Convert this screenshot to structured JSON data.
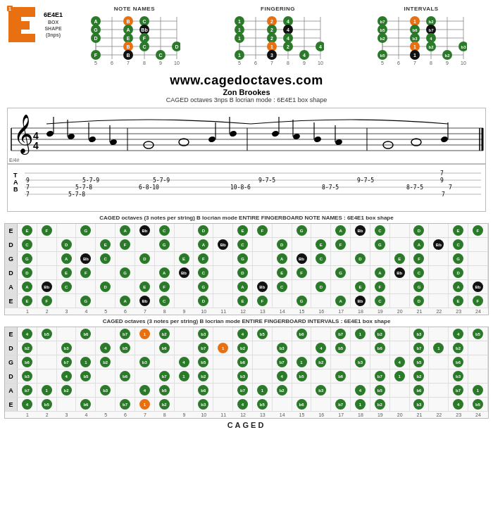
{
  "site": {
    "url": "www.cagedoctaves.com",
    "author": "Zon Brookes",
    "description": "CAGED octaves 3nps B locrian mode  : 6E4E1 box shape"
  },
  "shape": {
    "label": "6E4E1",
    "type": "BOX",
    "subtype": "SHAPE",
    "note": "(3nps)",
    "fret_number": "1"
  },
  "diagrams": {
    "note_names": {
      "title": "NOTE NAMES"
    },
    "fingering": {
      "title": "FINGERING"
    },
    "intervals": {
      "title": "INTERVALS"
    }
  },
  "tab": {
    "label_e": "E",
    "label_a": "A",
    "label_b": "B",
    "fret_markers": "5  6  7  8  9  10",
    "e_row": "e|-----------------------------------7-",
    "a_row": "A|9---------------------------------9--",
    "b_row": "B|7--5-7-8--5-7-9--6-8-10--10-8-6--8-7-5--9-7-5--8-7-5---7"
  },
  "fingerboard_notes": {
    "title1": "CAGED octaves (3 notes per string) B locrian mode ENTIRE FINGERBOARD  NOTE NAMES : 6E4E1 box  shape",
    "title2": "CAGED octaves (3 notes per string) B locrian mode ENTIRE FINGERBOARD INTERVALS : 6E4E1 box shape",
    "strings": [
      "E",
      "D",
      "G",
      "D",
      "A",
      "E"
    ],
    "fret_numbers": [
      "1",
      "2",
      "3",
      "4",
      "5",
      "6",
      "7",
      "8",
      "9",
      "10",
      "11",
      "12",
      "13",
      "14",
      "15",
      "16",
      "17",
      "18",
      "19",
      "20",
      "21",
      "22",
      "23",
      "24"
    ],
    "note_rows": [
      [
        "E",
        "F",
        "",
        "G",
        "",
        "A",
        "Bb",
        "C",
        "",
        "D",
        "",
        "E",
        "F",
        "",
        "G",
        "",
        "A",
        "Bb",
        "C",
        "",
        "D",
        "",
        "E",
        "F"
      ],
      [
        "C",
        "",
        "D",
        "",
        "E",
        "F",
        "",
        "G",
        "",
        "A",
        "Bb",
        "C",
        "",
        "D",
        "",
        "E",
        "F",
        "",
        "G",
        "",
        "A",
        "Bb",
        "C",
        ""
      ],
      [
        "G",
        "",
        "A",
        "Bb",
        "C",
        "",
        "D",
        "",
        "E",
        "F",
        "",
        "G",
        "",
        "A",
        "Bb",
        "C",
        "",
        "D",
        "",
        "E",
        "F",
        "",
        "G",
        ""
      ],
      [
        "D",
        "",
        "E",
        "F",
        "",
        "G",
        "",
        "A",
        "Bb",
        "C",
        "",
        "D",
        "",
        "E",
        "F",
        "",
        "G",
        "",
        "A",
        "Bb",
        "C",
        "",
        "D",
        ""
      ],
      [
        "A",
        "Bb",
        "C",
        "",
        "D",
        "",
        "E",
        "F",
        "",
        "G",
        "",
        "A",
        "Bb",
        "C",
        "",
        "D",
        "",
        "E",
        "F",
        "",
        "G",
        "",
        "A",
        "Bb"
      ],
      [
        "E",
        "F",
        "",
        "G",
        "",
        "A",
        "Bb",
        "C",
        "",
        "D",
        "",
        "E",
        "F",
        "",
        "G",
        "",
        "A",
        "Bb",
        "C",
        "",
        "D",
        "",
        "E",
        "F"
      ]
    ],
    "highlight_notes": {
      "green": [
        "B",
        "B",
        "B",
        "B",
        "B",
        "B"
      ],
      "orange": [
        "B",
        "B",
        "B",
        "B",
        "B",
        "B"
      ]
    },
    "interval_rows": [
      [
        "4",
        "b5",
        "",
        "b6",
        "",
        "b7",
        "1",
        "b2",
        "",
        "b3",
        "",
        "4",
        "b5",
        "",
        "b6",
        "",
        "b7",
        "1",
        "b2",
        "",
        "b3",
        "",
        "4",
        "b5"
      ],
      [
        "b2",
        "",
        "b3",
        "",
        "4",
        "b5",
        "",
        "b6",
        "",
        "b7",
        "1",
        "b2",
        "",
        "b3",
        "",
        "4",
        "b5",
        "",
        "b6",
        "",
        "b7",
        "1",
        "b2",
        ""
      ],
      [
        "b6",
        "",
        "b7",
        "1",
        "b2",
        "",
        "b3",
        "",
        "4",
        "b5",
        "",
        "b6",
        "",
        "b7",
        "1",
        "b2",
        "",
        "b3",
        "",
        "4",
        "b5",
        "",
        "b6",
        ""
      ],
      [
        "b3",
        "",
        "4",
        "b5",
        "",
        "b6",
        "",
        "b7",
        "1",
        "b2",
        "",
        "b3",
        "",
        "4",
        "b5",
        "",
        "b6",
        "",
        "b7",
        "1",
        "b2",
        "",
        "b3",
        ""
      ],
      [
        "b7",
        "1",
        "b2",
        "",
        "b3",
        "",
        "4",
        "b5",
        "",
        "b6",
        "",
        "b7",
        "1",
        "b2",
        "",
        "b3",
        "",
        "4",
        "b5",
        "",
        "b6",
        "",
        "b7",
        "1"
      ],
      [
        "4",
        "b5",
        "",
        "b6",
        "",
        "b7",
        "1",
        "b2",
        "",
        "b3",
        "",
        "4",
        "b5",
        "",
        "b6",
        "",
        "b7",
        "1",
        "b2",
        "",
        "b3",
        "",
        "4",
        "b5"
      ]
    ]
  },
  "caged_label": "CAGED"
}
